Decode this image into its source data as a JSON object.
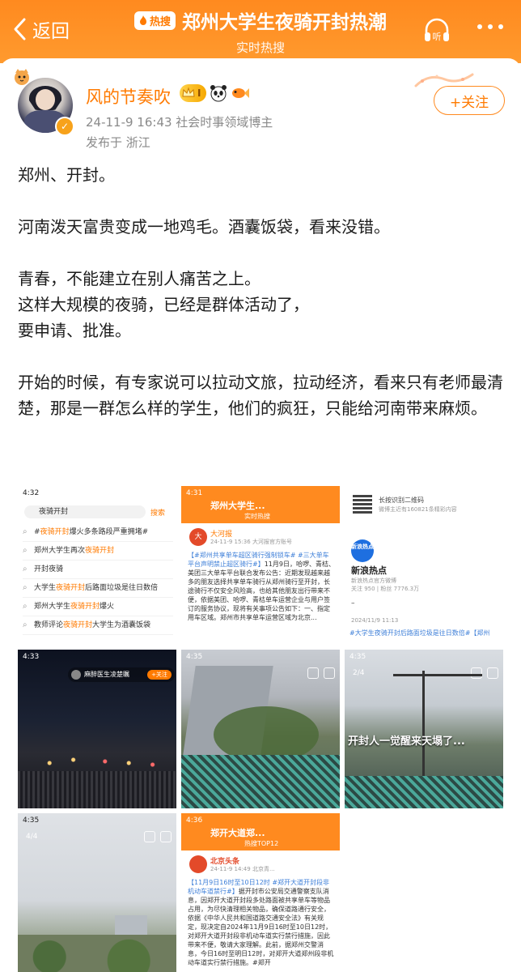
{
  "header": {
    "back_label": "返回",
    "hot_badge": "热搜",
    "title": "郑州大学生夜骑开封热潮",
    "subtitle": "实时热搜",
    "listen_label": "听"
  },
  "user": {
    "name": "风的节奏吹",
    "level": "I",
    "meta": "24-11-9 16:43  社会时事领域博主",
    "location": "发布于 浙江",
    "follow_label": "+关注"
  },
  "post": {
    "paragraphs": [
      "郑州、开封。",
      "河南泼天富贵变成一地鸡毛。酒囊饭袋，看来没错。",
      "青春，不能建立在别人痛苦之上。\n这样大规模的夜骑，已经是群体活动了，\n要申请、批准。",
      "开始的时候，有专家说可以拉动文旅，拉动经济，看来只有老师最清楚，那是一群怎么样的学生，他们的疯狂，只能给河南带来麻烦。"
    ]
  },
  "images": {
    "c1": {
      "time": "4:32",
      "search_value": "夜骑开封",
      "search_go": "搜索",
      "rows": [
        {
          "pre": "#",
          "hl": "夜骑开封",
          "post": "爆火多条路段严重拥堵#"
        },
        {
          "pre": "郑州大学生再次",
          "hl": "夜骑开封",
          "post": ""
        },
        {
          "pre": "开封夜骑",
          "hl": "",
          "post": ""
        },
        {
          "pre": "大学生",
          "hl": "夜骑开封",
          "post": "后路面垃圾是往日数倍"
        },
        {
          "pre": "郑州大学生",
          "hl": "夜骑开封",
          "post": "爆火"
        },
        {
          "pre": "教师评论",
          "hl": "夜骑开封",
          "post": "大学生为酒囊饭袋"
        }
      ]
    },
    "c2": {
      "time": "4:31",
      "title": "郑州大学生...",
      "subtitle": "实时热搜",
      "source": "大河报",
      "source_meta": "24-11-9 15:36 大河报官方账号",
      "link": "【#郑州共享单车超区骑行强制锁车# #三大单车平台声明禁止超区骑行#】",
      "text": "11月9日，哈啰、青桔、美团三大单车平台联合发布公告：近期发现越来越多的朋友选择共享单车骑行从郑州骑行至开封，长途骑行不仅安全风险高，也给其他朋友出行带来不便，依据美团、哈啰、青桔单车运营企业与用户签订的服务协议，现将有关事项公告如下：一、指定用车区域。郑州市共享单车运营区域为北京..."
    },
    "c3": {
      "qr_label": "长按识别二维码",
      "qr_sub": "微博主近有160821条精彩内容",
      "logo_text": "新浪热点",
      "name": "新浪热点",
      "sub": "新浪热点官方微博",
      "stat": "关注 950 | 粉丝 7776.3万",
      "dash": "–",
      "date": "2024/11/9 11:13",
      "tag": "#大学生夜骑开封后路面垃圾是往日数倍#【郑州"
    },
    "c4": {
      "time": "4:33",
      "chip_name": "麻醉医生凌楚瞩",
      "chip_btn": "+关注"
    },
    "c5": {
      "time": "4:35"
    },
    "c6": {
      "time": "4:35",
      "count": "2/4",
      "caption": "开封人一觉醒来天塌了..."
    },
    "c7": {
      "time": "4:35",
      "count": "4/4"
    },
    "c8": {
      "time": "4:36",
      "title": "郑开大道郑...",
      "subtitle": "热搜TOP12",
      "source": "北京头条",
      "source_meta": "24-11-9 14:49 北京青...",
      "link": "【11月9日16时至10日12时 #郑开大道开封段非机动车道禁行#】",
      "text": "据开封市公安局交通警察支队消息，因郑开大道开封段多处路面被共享单车等物品占用，为尽快清理相关物品，确保道路通行安全，依据《中华人民共和国道路交通安全法》有关规定，现决定自2024年11月9日16时至10日12时，对郑开大道开封段非机动车道实行禁行措施，因此带来不便，敬请大家理解。此前，据郑州交警消息，今日16时至明日12时，对郑开大道郑州段非机动车道实行禁行措施。#郑开"
    }
  },
  "colors": {
    "brand_orange": "#ff8a1f",
    "username_orange": "#ff7a00",
    "link_blue": "#3e7fd8"
  }
}
